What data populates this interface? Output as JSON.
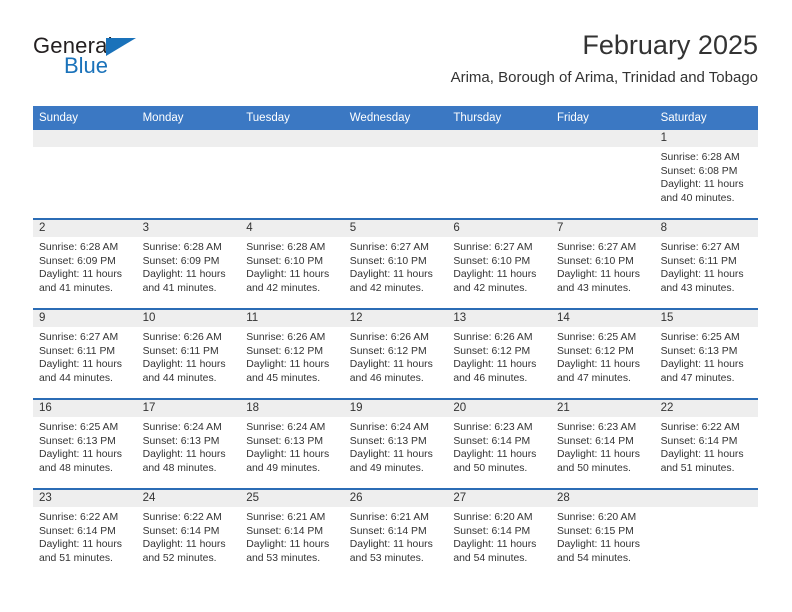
{
  "brand": {
    "name_part1": "General",
    "name_part2": "Blue",
    "accent_color": "#1a72ba"
  },
  "header": {
    "title": "February 2025",
    "subtitle": "Arima, Borough of Arima, Trinidad and Tobago"
  },
  "theme": {
    "header_bar_color": "#3b78c3",
    "row_divider_color": "#2b6cb5",
    "daynum_band_color": "#eeeeee",
    "text_color": "#333333"
  },
  "labels": {
    "sunrise": "Sunrise:",
    "sunset": "Sunset:",
    "daylight": "Daylight:"
  },
  "columns": [
    "Sunday",
    "Monday",
    "Tuesday",
    "Wednesday",
    "Thursday",
    "Friday",
    "Saturday"
  ],
  "weeks": [
    [
      {
        "day": "",
        "empty": true
      },
      {
        "day": "",
        "empty": true
      },
      {
        "day": "",
        "empty": true
      },
      {
        "day": "",
        "empty": true
      },
      {
        "day": "",
        "empty": true
      },
      {
        "day": "",
        "empty": true
      },
      {
        "day": "1",
        "sunrise": "Sunrise: 6:28 AM",
        "sunset": "Sunset: 6:08 PM",
        "daylight": "Daylight: 11 hours and 40 minutes."
      }
    ],
    [
      {
        "day": "2",
        "sunrise": "Sunrise: 6:28 AM",
        "sunset": "Sunset: 6:09 PM",
        "daylight": "Daylight: 11 hours and 41 minutes."
      },
      {
        "day": "3",
        "sunrise": "Sunrise: 6:28 AM",
        "sunset": "Sunset: 6:09 PM",
        "daylight": "Daylight: 11 hours and 41 minutes."
      },
      {
        "day": "4",
        "sunrise": "Sunrise: 6:28 AM",
        "sunset": "Sunset: 6:10 PM",
        "daylight": "Daylight: 11 hours and 42 minutes."
      },
      {
        "day": "5",
        "sunrise": "Sunrise: 6:27 AM",
        "sunset": "Sunset: 6:10 PM",
        "daylight": "Daylight: 11 hours and 42 minutes."
      },
      {
        "day": "6",
        "sunrise": "Sunrise: 6:27 AM",
        "sunset": "Sunset: 6:10 PM",
        "daylight": "Daylight: 11 hours and 42 minutes."
      },
      {
        "day": "7",
        "sunrise": "Sunrise: 6:27 AM",
        "sunset": "Sunset: 6:10 PM",
        "daylight": "Daylight: 11 hours and 43 minutes."
      },
      {
        "day": "8",
        "sunrise": "Sunrise: 6:27 AM",
        "sunset": "Sunset: 6:11 PM",
        "daylight": "Daylight: 11 hours and 43 minutes."
      }
    ],
    [
      {
        "day": "9",
        "sunrise": "Sunrise: 6:27 AM",
        "sunset": "Sunset: 6:11 PM",
        "daylight": "Daylight: 11 hours and 44 minutes."
      },
      {
        "day": "10",
        "sunrise": "Sunrise: 6:26 AM",
        "sunset": "Sunset: 6:11 PM",
        "daylight": "Daylight: 11 hours and 44 minutes."
      },
      {
        "day": "11",
        "sunrise": "Sunrise: 6:26 AM",
        "sunset": "Sunset: 6:12 PM",
        "daylight": "Daylight: 11 hours and 45 minutes."
      },
      {
        "day": "12",
        "sunrise": "Sunrise: 6:26 AM",
        "sunset": "Sunset: 6:12 PM",
        "daylight": "Daylight: 11 hours and 46 minutes."
      },
      {
        "day": "13",
        "sunrise": "Sunrise: 6:26 AM",
        "sunset": "Sunset: 6:12 PM",
        "daylight": "Daylight: 11 hours and 46 minutes."
      },
      {
        "day": "14",
        "sunrise": "Sunrise: 6:25 AM",
        "sunset": "Sunset: 6:12 PM",
        "daylight": "Daylight: 11 hours and 47 minutes."
      },
      {
        "day": "15",
        "sunrise": "Sunrise: 6:25 AM",
        "sunset": "Sunset: 6:13 PM",
        "daylight": "Daylight: 11 hours and 47 minutes."
      }
    ],
    [
      {
        "day": "16",
        "sunrise": "Sunrise: 6:25 AM",
        "sunset": "Sunset: 6:13 PM",
        "daylight": "Daylight: 11 hours and 48 minutes."
      },
      {
        "day": "17",
        "sunrise": "Sunrise: 6:24 AM",
        "sunset": "Sunset: 6:13 PM",
        "daylight": "Daylight: 11 hours and 48 minutes."
      },
      {
        "day": "18",
        "sunrise": "Sunrise: 6:24 AM",
        "sunset": "Sunset: 6:13 PM",
        "daylight": "Daylight: 11 hours and 49 minutes."
      },
      {
        "day": "19",
        "sunrise": "Sunrise: 6:24 AM",
        "sunset": "Sunset: 6:13 PM",
        "daylight": "Daylight: 11 hours and 49 minutes."
      },
      {
        "day": "20",
        "sunrise": "Sunrise: 6:23 AM",
        "sunset": "Sunset: 6:14 PM",
        "daylight": "Daylight: 11 hours and 50 minutes."
      },
      {
        "day": "21",
        "sunrise": "Sunrise: 6:23 AM",
        "sunset": "Sunset: 6:14 PM",
        "daylight": "Daylight: 11 hours and 50 minutes."
      },
      {
        "day": "22",
        "sunrise": "Sunrise: 6:22 AM",
        "sunset": "Sunset: 6:14 PM",
        "daylight": "Daylight: 11 hours and 51 minutes."
      }
    ],
    [
      {
        "day": "23",
        "sunrise": "Sunrise: 6:22 AM",
        "sunset": "Sunset: 6:14 PM",
        "daylight": "Daylight: 11 hours and 51 minutes."
      },
      {
        "day": "24",
        "sunrise": "Sunrise: 6:22 AM",
        "sunset": "Sunset: 6:14 PM",
        "daylight": "Daylight: 11 hours and 52 minutes."
      },
      {
        "day": "25",
        "sunrise": "Sunrise: 6:21 AM",
        "sunset": "Sunset: 6:14 PM",
        "daylight": "Daylight: 11 hours and 53 minutes."
      },
      {
        "day": "26",
        "sunrise": "Sunrise: 6:21 AM",
        "sunset": "Sunset: 6:14 PM",
        "daylight": "Daylight: 11 hours and 53 minutes."
      },
      {
        "day": "27",
        "sunrise": "Sunrise: 6:20 AM",
        "sunset": "Sunset: 6:14 PM",
        "daylight": "Daylight: 11 hours and 54 minutes."
      },
      {
        "day": "28",
        "sunrise": "Sunrise: 6:20 AM",
        "sunset": "Sunset: 6:15 PM",
        "daylight": "Daylight: 11 hours and 54 minutes."
      },
      {
        "day": "",
        "empty": true
      }
    ]
  ]
}
